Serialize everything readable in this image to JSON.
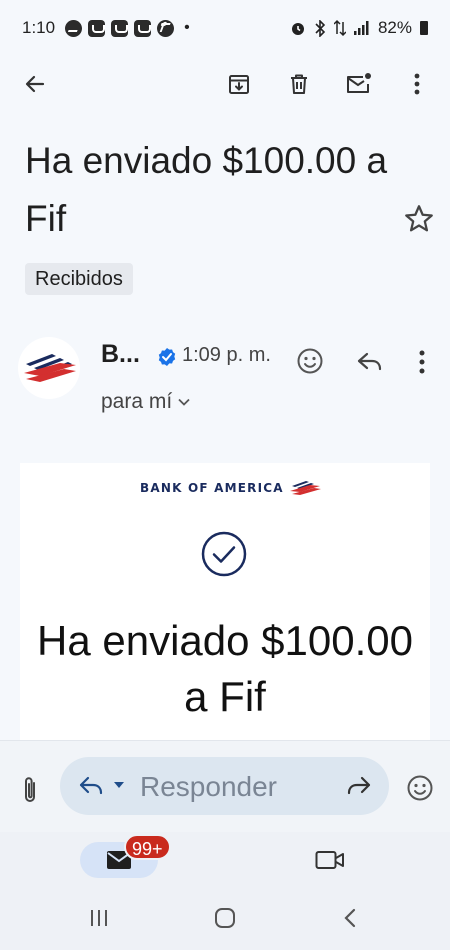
{
  "status_bar": {
    "time": "1:10",
    "battery": "82%",
    "notification_icons": [
      "messenger-icon",
      "mailbox-icon",
      "mailbox-icon",
      "mailbox-icon",
      "facebook-icon"
    ],
    "system_icons": [
      "alarm-icon",
      "bluetooth-icon",
      "data-icon",
      "signal-icon",
      "battery-icon"
    ]
  },
  "app_bar": {
    "icons": [
      "back-arrow-icon",
      "archive-icon",
      "delete-icon",
      "mark-unread-icon",
      "more-vertical-icon"
    ]
  },
  "email": {
    "subject": "Ha enviado $100.00 a Fif",
    "label": "Recibidos",
    "sender": "B...",
    "time": "1:09 p. m.",
    "recipient": "para mí"
  },
  "card": {
    "brand": "BANK OF AMERICA",
    "heading": "Ha enviado $100.00 a Fif"
  },
  "reply_bar": {
    "placeholder": "Responder"
  },
  "bottom_nav": {
    "badge": "99+"
  },
  "colors": {
    "background": "#f5f8fc",
    "brand_navy": "#1a2b5e",
    "brand_red": "#d32f2f",
    "verified_blue": "#1a73e8",
    "badge_red": "#c92a1d",
    "pill": "#dce6f0"
  }
}
